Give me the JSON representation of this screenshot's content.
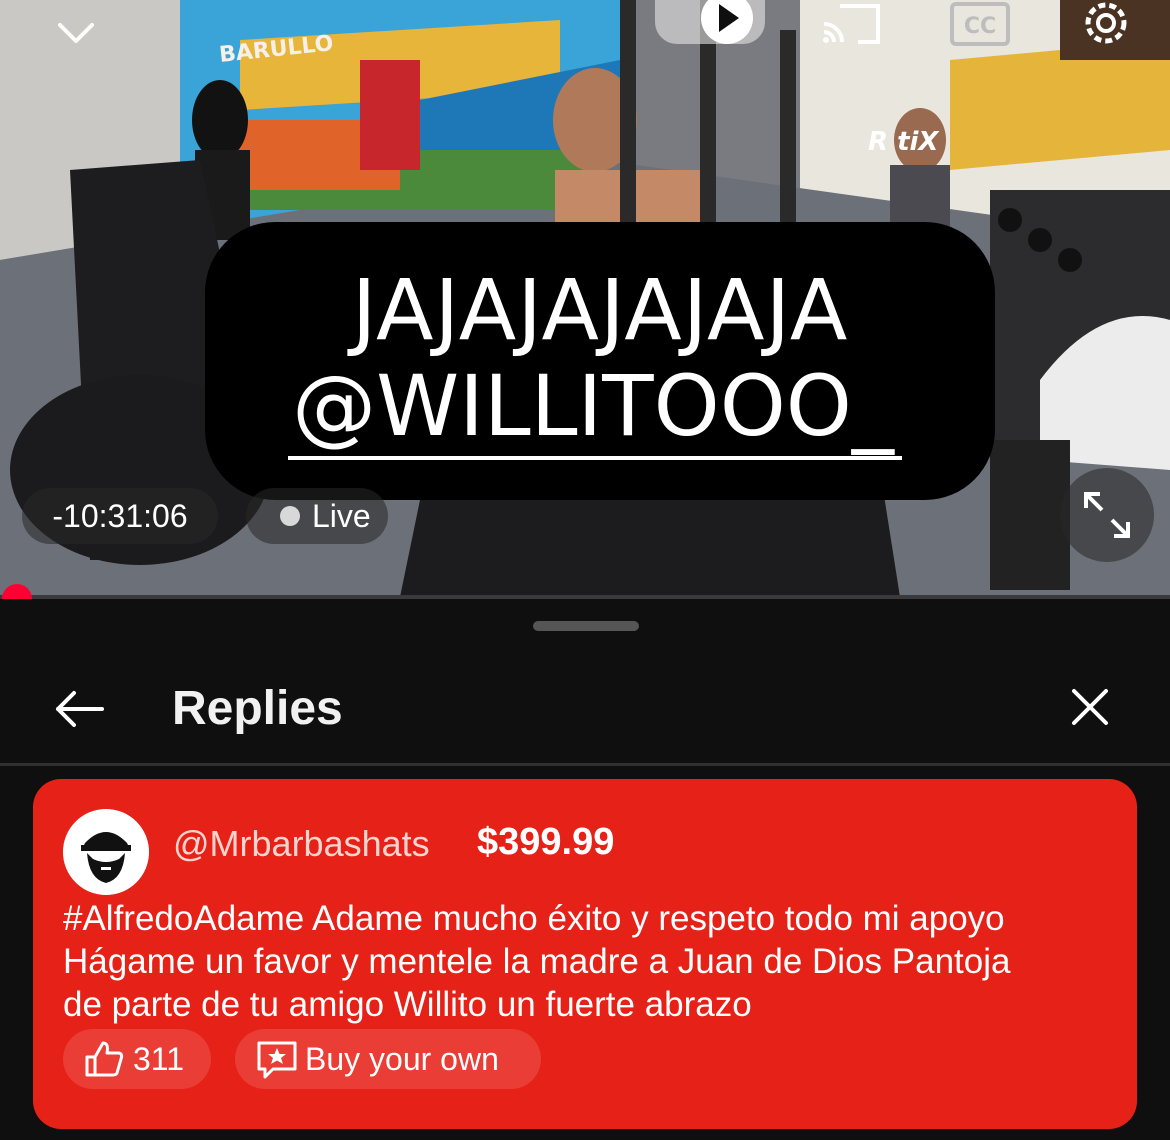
{
  "video": {
    "caption_line1": "JAJAJAJAJAJA",
    "caption_line2": "@WILLITOOO_",
    "time": "-10:31:06",
    "live_label": "Live",
    "progress_color": "#ff0033",
    "sign_barullo": "BARULLO",
    "sign_gym": "R    tiX",
    "icons": [
      "chevron-down-icon",
      "play-icon",
      "cast-icon",
      "captions-icon",
      "settings-icon",
      "fullscreen-icon"
    ],
    "cc_label": "CC"
  },
  "panel": {
    "title": "Replies",
    "back_icon": "arrow-left-icon",
    "close_icon": "close-icon"
  },
  "superchat": {
    "author": "@Mrbarbashats",
    "amount": "$399.99",
    "message_lines": [
      "#AlfredoAdame Adame mucho éxito y respeto todo mi apoyo",
      "Hágame un favor y mentele la madre a Juan de Dios Pantoja",
      "de parte de tu amigo Willito un fuerte abrazo"
    ],
    "like_count": "311",
    "buy_label": "Buy your own",
    "card_color": "#e62117"
  }
}
